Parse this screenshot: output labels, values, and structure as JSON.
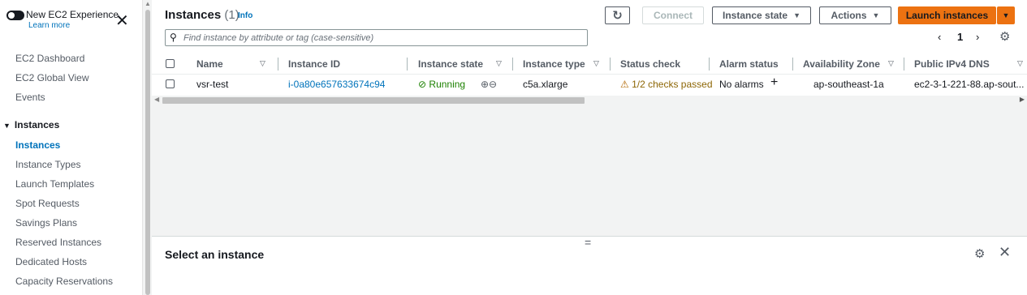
{
  "sidebar": {
    "toggle_label": "New EC2 Experience",
    "learn_more": "Learn more",
    "close_glyph": "✕",
    "items_top": [
      "EC2 Dashboard",
      "EC2 Global View",
      "Events"
    ],
    "section_title": "Instances",
    "section_glyph": "▼",
    "section_items": [
      "Instances",
      "Instance Types",
      "Launch Templates",
      "Spot Requests",
      "Savings Plans",
      "Reserved Instances",
      "Dedicated Hosts",
      "Capacity Reservations"
    ],
    "active_item": "Instances"
  },
  "header": {
    "title": "Instances",
    "count": "(1)",
    "info": "Info"
  },
  "toolbar": {
    "refresh_glyph": "↻",
    "connect": "Connect",
    "instance_state": "Instance state",
    "actions": "Actions",
    "launch": "Launch instances",
    "caret": "▼"
  },
  "search": {
    "placeholder": "Find instance by attribute or tag (case-sensitive)",
    "icon_glyph": "⚲"
  },
  "pagination": {
    "prev": "‹",
    "page": "1",
    "next": "›",
    "settings_glyph": "⚙"
  },
  "table": {
    "columns": [
      "Name",
      "Instance ID",
      "Instance state",
      "Instance type",
      "Status check",
      "Alarm status",
      "Availability Zone",
      "Public IPv4 DNS"
    ],
    "sort_glyph": "▽",
    "rows": [
      {
        "name": "vsr-test",
        "instance_id": "i-0a80e657633674c94",
        "state": "Running",
        "state_glyph": "⊘",
        "zoom_glyphs": "⊕⊖",
        "type": "c5a.xlarge",
        "status_glyph": "⚠",
        "status_check": "1/2 checks passed",
        "alarm_status": "No alarms",
        "alarm_add": "+",
        "az": "ap-southeast-1a",
        "dns": "ec2-3-1-221-88.ap-sout..."
      }
    ]
  },
  "bottom_panel": {
    "title": "Select an instance",
    "drag_glyph": "=",
    "gear_glyph": "⚙",
    "close_glyph": "✕"
  },
  "colors": {
    "link": "#0073bb",
    "running": "#1d8102",
    "warning": "#8d6605",
    "primary": "#ec7211"
  }
}
